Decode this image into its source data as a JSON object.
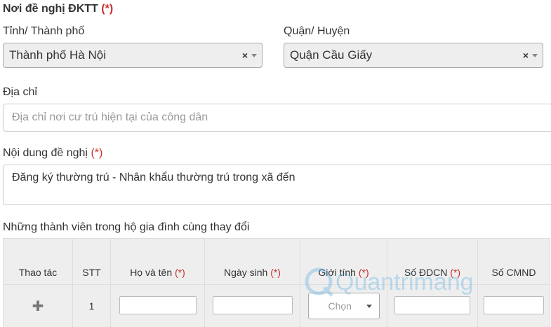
{
  "section": {
    "title": "Nơi đề nghị ĐKTT",
    "required_mark": "(*)"
  },
  "province": {
    "label": "Tỉnh/ Thành phố",
    "value": "Thành phố Hà Nội",
    "clear": "×"
  },
  "district": {
    "label": "Quận/ Huyện",
    "value": "Quận Cầu Giấy",
    "clear": "×"
  },
  "address": {
    "label": "Địa chỉ",
    "placeholder": "Địa chỉ nơi cư trú hiện tại của công dân"
  },
  "request_content": {
    "label": "Nội dung đề nghị",
    "required_mark": "(*)",
    "value": "Đăng ký thường trú - Nhân khẩu thường trú trong xã đến"
  },
  "members": {
    "title": "Những thành viên trong hộ gia đình cùng thay đổi",
    "columns": [
      {
        "label": "Thao tác",
        "required": ""
      },
      {
        "label": "STT",
        "required": ""
      },
      {
        "label": "Họ và tên",
        "required": "(*)"
      },
      {
        "label": "Ngày sinh",
        "required": "(*)"
      },
      {
        "label": "Giới tính",
        "required": "(*)"
      },
      {
        "label": "Số ĐDCN",
        "required": "(*)"
      },
      {
        "label": "Số CMND",
        "required": ""
      }
    ],
    "rows": [
      {
        "stt": "1",
        "gender": "Chọn"
      }
    ]
  },
  "watermark": {
    "text": "Quantrimang"
  }
}
